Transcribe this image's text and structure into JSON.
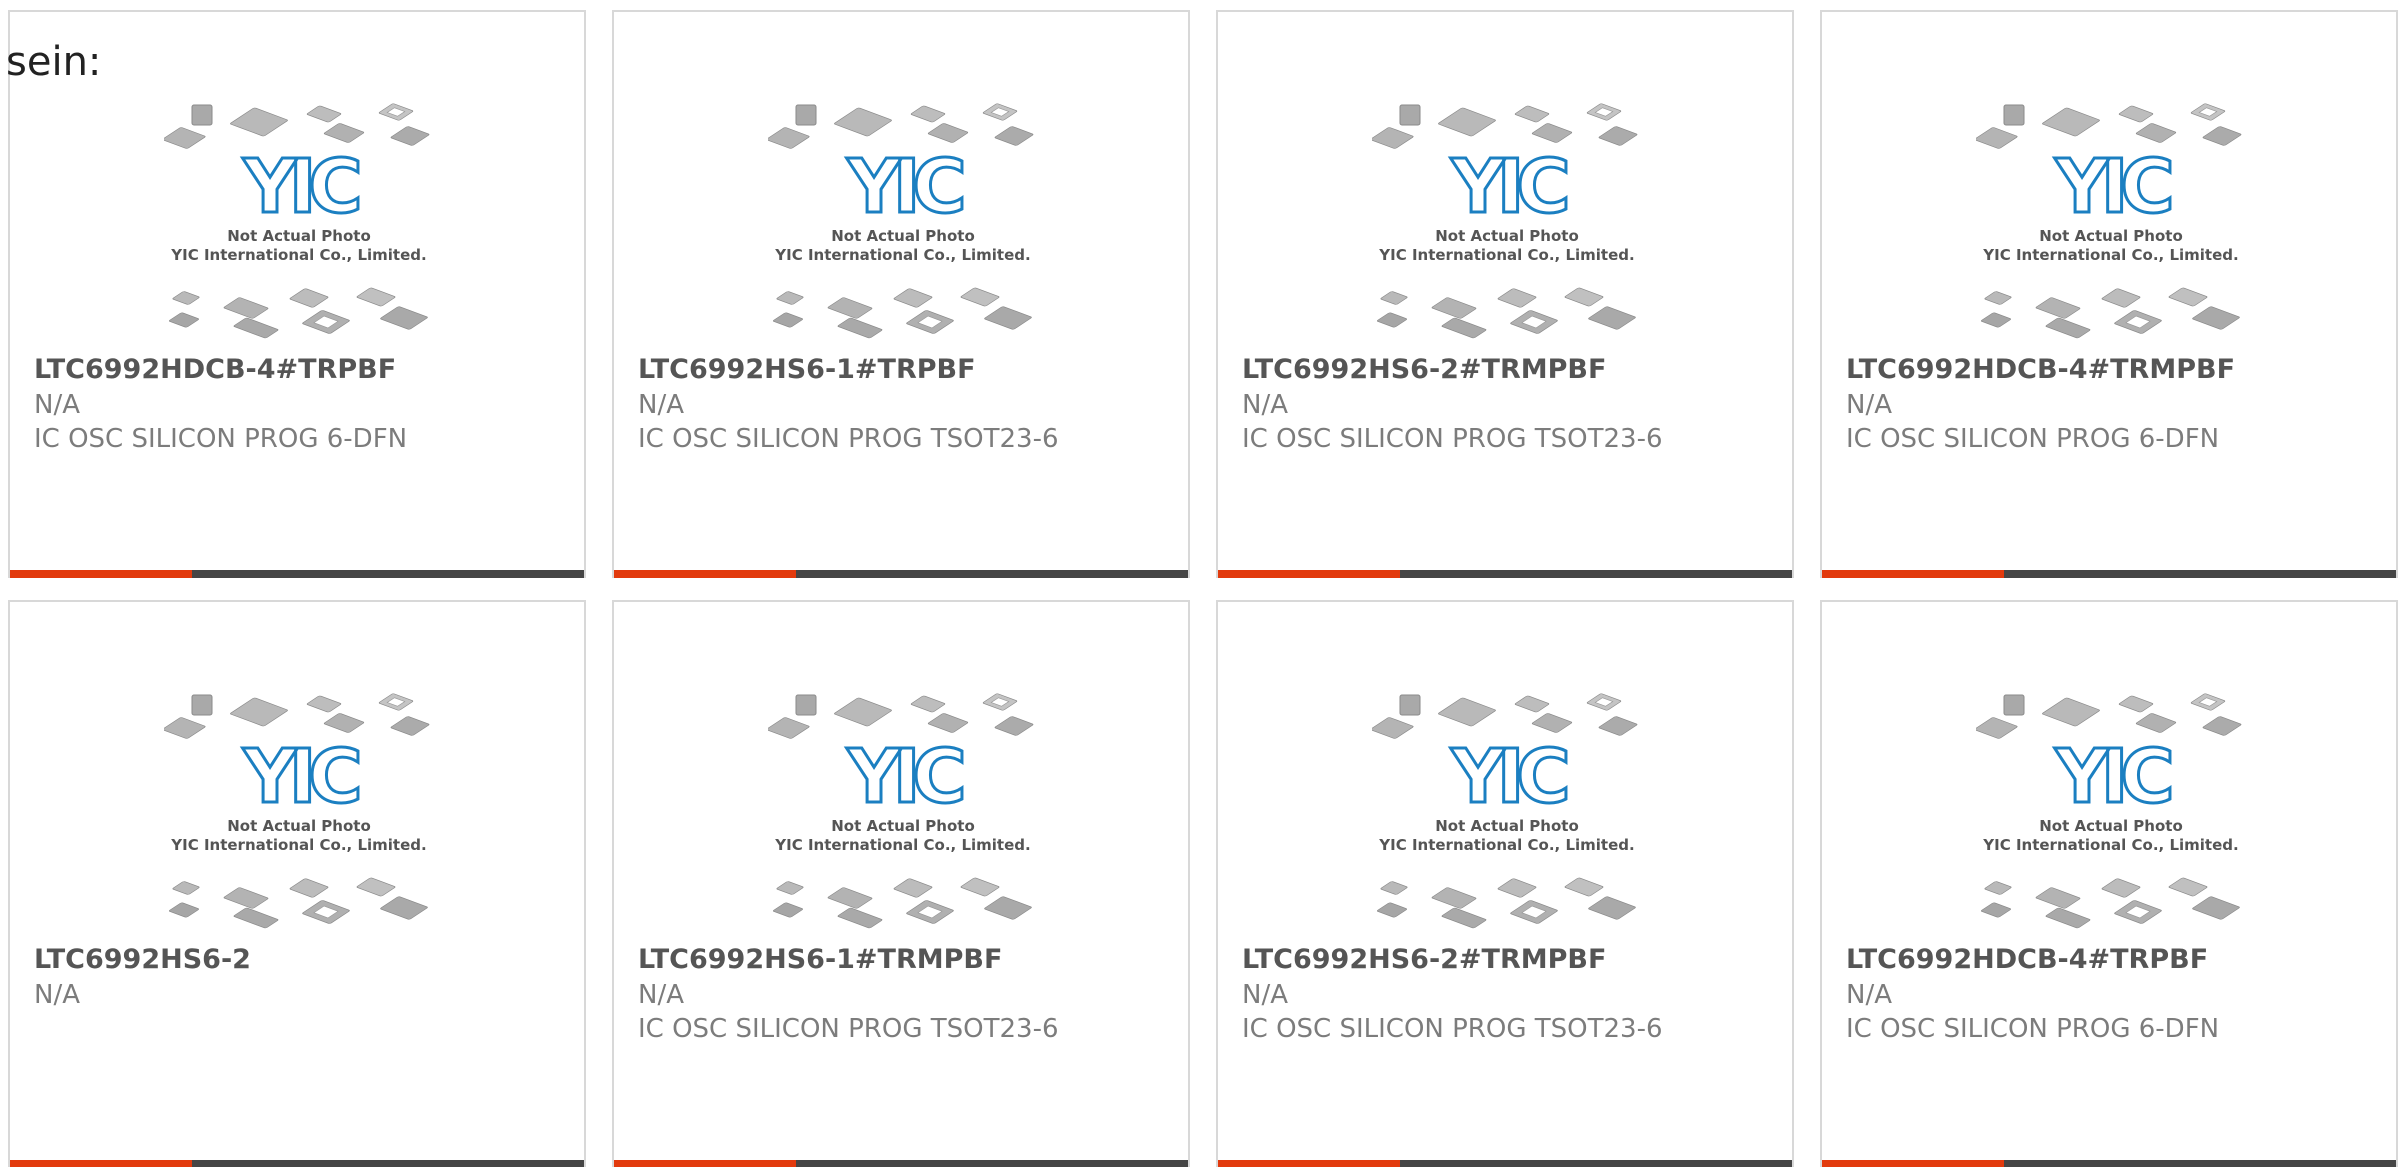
{
  "prefix_text": "sein:",
  "image": {
    "logo_text": "YIC",
    "caption_line1": "Not Actual Photo",
    "caption_line2": "YIC International Co., Limited.",
    "icon": "chip-packages-placeholder-icon"
  },
  "colors": {
    "accent": "#e23a0d",
    "bar_dark": "#454545",
    "logo_blue": "#1b7fc1",
    "title_gray": "#555555",
    "text_gray": "#7c7c7c"
  },
  "products": [
    {
      "part_number": "LTC6992HDCB-4#TRPBF",
      "manufacturer": "N/A",
      "description": "IC OSC SILICON PROG 6-DFN"
    },
    {
      "part_number": "LTC6992HS6-1#TRPBF",
      "manufacturer": "N/A",
      "description": "IC OSC SILICON PROG TSOT23-6"
    },
    {
      "part_number": "LTC6992HS6-2#TRMPBF",
      "manufacturer": "N/A",
      "description": "IC OSC SILICON PROG TSOT23-6"
    },
    {
      "part_number": "LTC6992HDCB-4#TRMPBF",
      "manufacturer": "N/A",
      "description": "IC OSC SILICON PROG 6-DFN"
    },
    {
      "part_number": "LTC6992HS6-2",
      "manufacturer": "N/A",
      "description": ""
    },
    {
      "part_number": "LTC6992HS6-1#TRMPBF",
      "manufacturer": "N/A",
      "description": "IC OSC SILICON PROG TSOT23-6"
    },
    {
      "part_number": "LTC6992HS6-2#TRMPBF",
      "manufacturer": "N/A",
      "description": "IC OSC SILICON PROG TSOT23-6"
    },
    {
      "part_number": "LTC6992HDCB-4#TRPBF",
      "manufacturer": "N/A",
      "description": "IC OSC SILICON PROG 6-DFN"
    }
  ]
}
